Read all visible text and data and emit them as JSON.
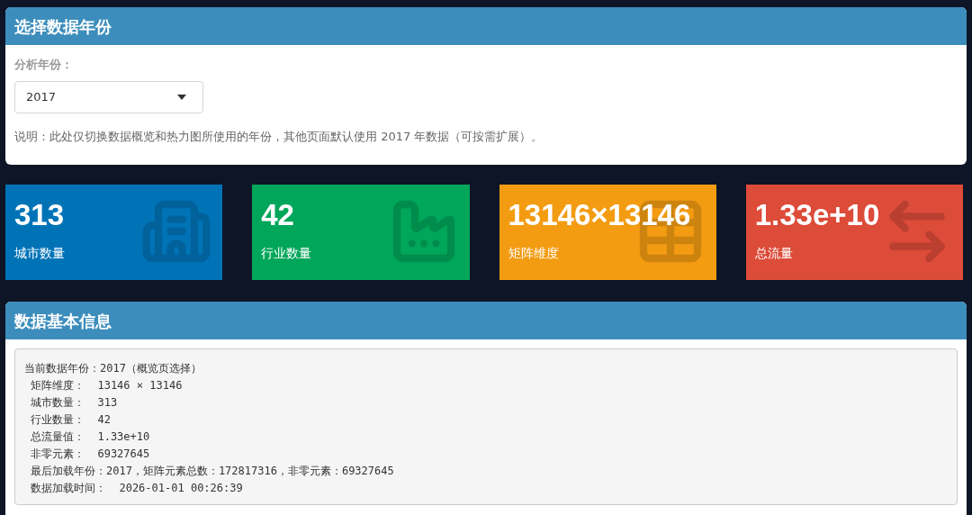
{
  "year_panel": {
    "title": "选择数据年份",
    "field_label": "分析年份：",
    "select": {
      "value": "2017"
    },
    "note": "说明：此处仅切换数据概览和热力图所使用的年份，其他页面默认使用 2017 年数据（可按需扩展）。"
  },
  "stat_cards": [
    {
      "value": "313",
      "label": "城市数量",
      "color": "#0073b7"
    },
    {
      "value": "42",
      "label": "行业数量",
      "color": "#00a65a"
    },
    {
      "value": "13146×13146",
      "label": "矩阵维度",
      "color": "#f39c12"
    },
    {
      "value": "1.33e+10",
      "label": "总流量",
      "color": "#dd4b39"
    }
  ],
  "info_panel": {
    "title": "数据基本信息",
    "lines": [
      "当前数据年份：2017（概览页选择）",
      "矩阵维度：  13146 × 13146",
      "城市数量：  313",
      "行业数量：  42",
      "总流量值：  1.33e+10",
      "非零元素：  69327645",
      "最后加载年份：2017，矩阵元素总数：172817316，非零元素：69327645",
      "数据加载时间：  2026-01-01 00:26:39"
    ]
  }
}
